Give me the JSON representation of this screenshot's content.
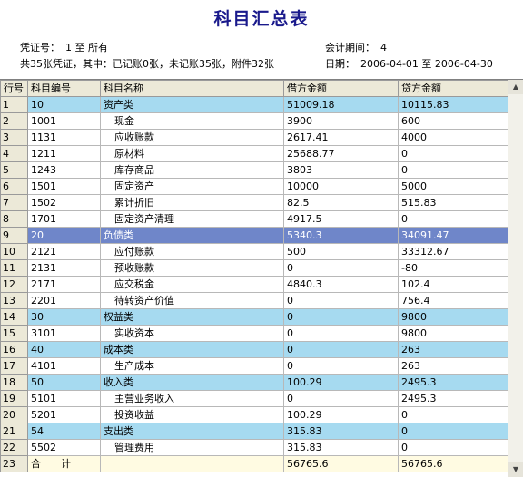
{
  "title": "科目汇总表",
  "header": {
    "voucher_label": "凭证号：",
    "voucher_value": "1 至 所有",
    "summary": "共35张凭证，其中：已记账0张，未记账35张，附件32张",
    "period_label": "会计期间：",
    "period_value": "4",
    "date_label": "日期：",
    "date_value": "2006-04-01 至 2006-04-30"
  },
  "columns": [
    "行号",
    "科目编号",
    "科目名称",
    "借方金额",
    "贷方金额"
  ],
  "rows": [
    {
      "no": "1",
      "code": "10",
      "name": "资产类",
      "debit": "51009.18",
      "credit": "10115.83",
      "type": "cat"
    },
    {
      "no": "2",
      "code": "1001",
      "name": "现金",
      "debit": "3900",
      "credit": "600",
      "type": "sub"
    },
    {
      "no": "3",
      "code": "1131",
      "name": "应收账款",
      "debit": "2617.41",
      "credit": "4000",
      "type": "sub"
    },
    {
      "no": "4",
      "code": "1211",
      "name": "原材料",
      "debit": "25688.77",
      "credit": "0",
      "type": "sub"
    },
    {
      "no": "5",
      "code": "1243",
      "name": "库存商品",
      "debit": "3803",
      "credit": "0",
      "type": "sub"
    },
    {
      "no": "6",
      "code": "1501",
      "name": "固定资产",
      "debit": "10000",
      "credit": "5000",
      "type": "sub"
    },
    {
      "no": "7",
      "code": "1502",
      "name": "累计折旧",
      "debit": "82.5",
      "credit": "515.83",
      "type": "sub"
    },
    {
      "no": "8",
      "code": "1701",
      "name": "固定资产清理",
      "debit": "4917.5",
      "credit": "0",
      "type": "sub"
    },
    {
      "no": "9",
      "code": "20",
      "name": "负债类",
      "debit": "5340.3",
      "credit": "34091.47",
      "type": "sel"
    },
    {
      "no": "10",
      "code": "2121",
      "name": "应付账款",
      "debit": "500",
      "credit": "33312.67",
      "type": "sub"
    },
    {
      "no": "11",
      "code": "2131",
      "name": "预收账款",
      "debit": "0",
      "credit": "-80",
      "type": "sub"
    },
    {
      "no": "12",
      "code": "2171",
      "name": "应交税金",
      "debit": "4840.3",
      "credit": "102.4",
      "type": "sub"
    },
    {
      "no": "13",
      "code": "2201",
      "name": "待转资产价值",
      "debit": "0",
      "credit": "756.4",
      "type": "sub"
    },
    {
      "no": "14",
      "code": "30",
      "name": "权益类",
      "debit": "0",
      "credit": "9800",
      "type": "cat"
    },
    {
      "no": "15",
      "code": "3101",
      "name": "实收资本",
      "debit": "0",
      "credit": "9800",
      "type": "sub"
    },
    {
      "no": "16",
      "code": "40",
      "name": "成本类",
      "debit": "0",
      "credit": "263",
      "type": "cat"
    },
    {
      "no": "17",
      "code": "4101",
      "name": "生产成本",
      "debit": "0",
      "credit": "263",
      "type": "sub"
    },
    {
      "no": "18",
      "code": "50",
      "name": "收入类",
      "debit": "100.29",
      "credit": "2495.3",
      "type": "cat"
    },
    {
      "no": "19",
      "code": "5101",
      "name": "主营业务收入",
      "debit": "0",
      "credit": "2495.3",
      "type": "sub"
    },
    {
      "no": "20",
      "code": "5201",
      "name": "投资收益",
      "debit": "100.29",
      "credit": "0",
      "type": "sub"
    },
    {
      "no": "21",
      "code": "54",
      "name": "支出类",
      "debit": "315.83",
      "credit": "0",
      "type": "cat"
    },
    {
      "no": "22",
      "code": "5502",
      "name": "管理费用",
      "debit": "315.83",
      "credit": "0",
      "type": "sub"
    },
    {
      "no": "23",
      "code": "合　　计",
      "name": "",
      "debit": "56765.6",
      "credit": "56765.6",
      "type": "total"
    }
  ]
}
